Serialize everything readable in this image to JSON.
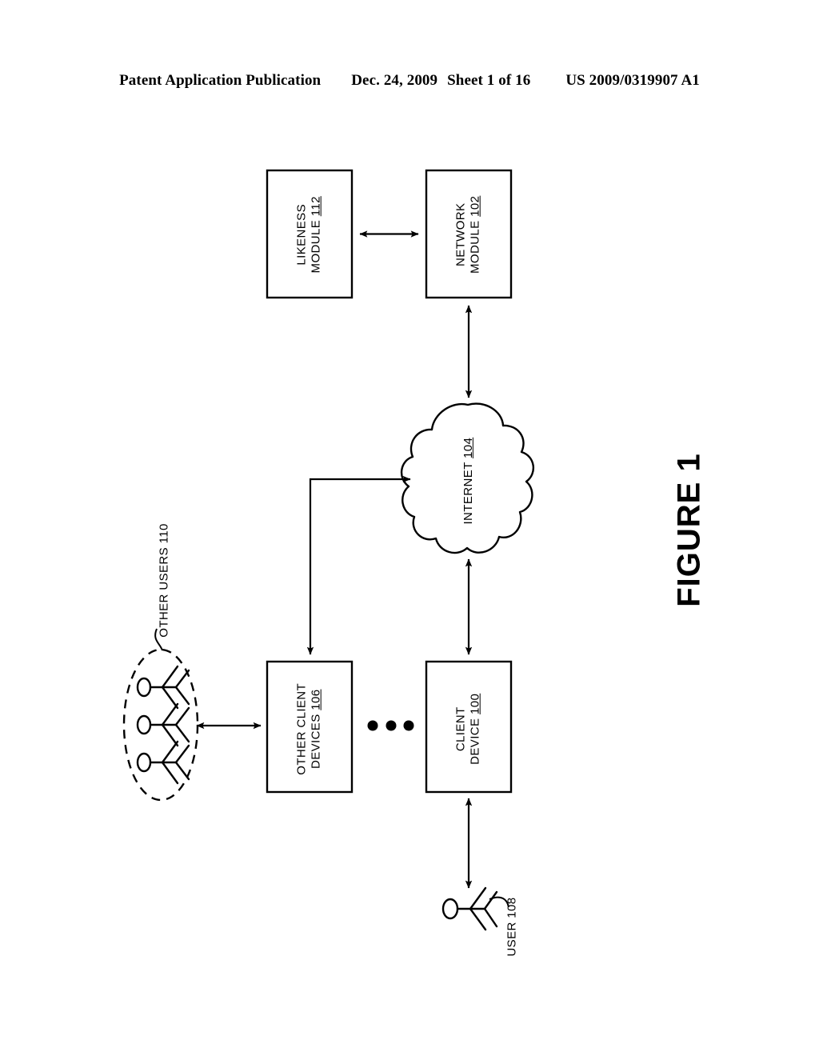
{
  "header": {
    "publication": "Patent Application Publication",
    "date": "Dec. 24, 2009",
    "sheet": "Sheet 1 of 16",
    "doc_number": "US 2009/0319907 A1"
  },
  "figure": {
    "title": "FIGURE 1",
    "caption_dots": "• • •"
  },
  "nodes": {
    "likeness_module": {
      "line1": "LIKENESS",
      "line2": "MODULE",
      "ref": "112"
    },
    "network_module": {
      "line1": "NETWORK",
      "line2": "MODULE",
      "ref": "102"
    },
    "internet": {
      "line1": "INTERNET",
      "ref": "104"
    },
    "other_client_devices": {
      "line1": "OTHER CLIENT",
      "line2": "DEVICES",
      "ref": "106"
    },
    "client_device": {
      "line1": "CLIENT",
      "line2": "DEVICE",
      "ref": "100"
    },
    "other_users": {
      "label": "OTHER USERS 110"
    },
    "user": {
      "label": "USER 108"
    }
  },
  "colors": {
    "stroke": "#000000",
    "background": "#ffffff"
  }
}
